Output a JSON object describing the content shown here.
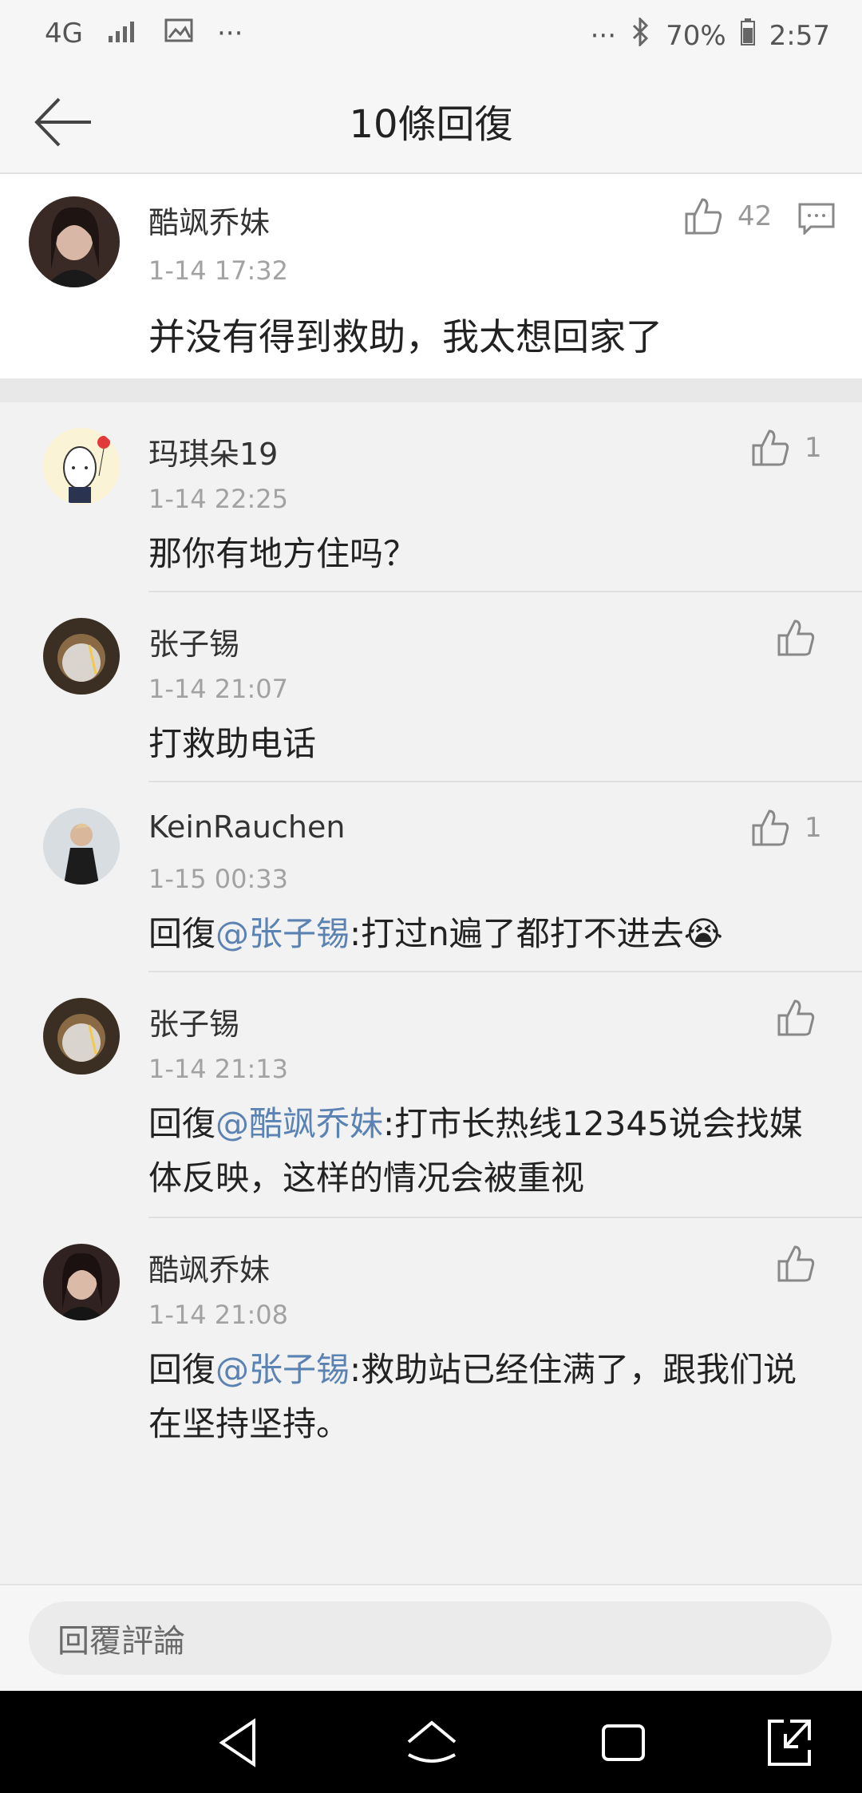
{
  "status": {
    "network": "4G",
    "battery": "70%",
    "time": "2:57",
    "dots": "···"
  },
  "header": {
    "title": "10條回復"
  },
  "main": {
    "name": "酷飒乔妹",
    "time": "1-14 17:32",
    "text": "并没有得到救助，我太想回家了",
    "likes": "42"
  },
  "replies": [
    {
      "name": "玛琪朵19",
      "time": "1-14 22:25",
      "prefix": "",
      "mention": "",
      "text": "那你有地方住吗？",
      "likes": "1"
    },
    {
      "name": "张子锡",
      "time": "1-14 21:07",
      "prefix": "",
      "mention": "",
      "text": "打救助电话",
      "likes": ""
    },
    {
      "name": "KeinRauchen",
      "time": "1-15 00:33",
      "prefix": "回復",
      "mention": "@张子锡",
      "text": ":打过n遍了都打不进去😭",
      "likes": "1"
    },
    {
      "name": "张子锡",
      "time": "1-14 21:13",
      "prefix": "回復",
      "mention": "@酷飒乔妹",
      "text": ":打市长热线12345说会找媒",
      "text2": "体反映，这样的情况会被重视",
      "likes": ""
    },
    {
      "name": "酷飒乔妹",
      "time": "1-14 21:08",
      "prefix": "回復",
      "mention": "@张子锡",
      "text": ":救助站已经住满了，跟我们说",
      "text2": "在坚持坚持。",
      "likes": ""
    }
  ],
  "footer": {
    "placeholder": "回覆評論"
  },
  "colors": {
    "mention": "#5a82b2",
    "background": "#f2f2f2"
  }
}
